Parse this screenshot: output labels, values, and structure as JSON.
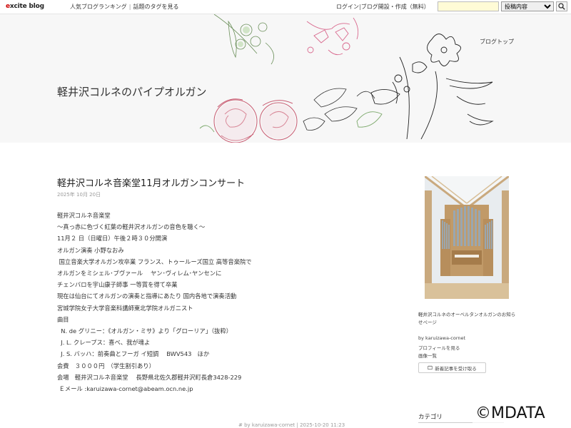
{
  "topbar": {
    "logo_prefix": "e",
    "logo_rest": "xcite blog",
    "ranking_link": "人気ブログランキング",
    "tags_link": "話題のタグを見る",
    "login_link": "ログイン",
    "create_link": "ブログ開設・作成（無料）",
    "search_value": "",
    "search_option": "投稿内容"
  },
  "header": {
    "blog_title": "軽井沢コルネのパイプオルガン",
    "blog_top_link": "ブログトップ"
  },
  "post": {
    "title": "軽井沢コルネ音楽堂11月オルガンコンサート",
    "date": "2025年 10月 20日",
    "lines": [
      "軽井沢コルネ音楽堂",
      "～真っ赤に色づく紅葉の軽井沢オルガンの音色を聴く～",
      "11月２ 日（日曜日）午後２時３０分開演",
      "オルガン演奏 小野なおみ",
      " 国立音楽大学オルガン攻卒業 フランス、トゥールーズ国立 高等音楽院で",
      "オルガンをミシェル･ブヴァール　 ヤン･ヴィレム･ヤンセンに",
      "チェンバロを宇山康子師事 一等賞を得て卒業",
      "現在は仙台にてオルガンの演奏と指導にあたり 国内各地で演奏活動",
      "宮城学院女子大学音楽科講師東北学院オルガニスト",
      "曲目",
      "  N. de グリニー：《オルガン・ミサ》より「グローリア」（抜粋）",
      "  J. L. クレープス：喜べ、我が魂よ",
      "  J. S. バッハ：前奏曲とフーガ イ短調　 BWV543　ほか",
      "会費　３０００円　（学生割引あり）",
      "会場　軽井沢コルネ音楽堂　 長野県北佐久郡軽井沢町長倉3428-229",
      " Ｅメール :karuizawa-cornet@abeam.ocn.ne.jp"
    ],
    "footer": "# by karuizawa-cornet | 2025-10-20 11:23"
  },
  "sidebar": {
    "caption": "軽井沢コルネのオーベルタンオルガンのお知らせページ",
    "by": "by karuizawa-cornet",
    "profile": "プロフィールを見る",
    "images": "画像一覧",
    "notify": "新着記事を受け取る",
    "category": "カテゴリ"
  },
  "watermark": "©MDATA",
  "colors": {
    "accent_red": "#cc0000",
    "search_bg": "#fffbd6",
    "header_bg": "#f7f7f7"
  }
}
